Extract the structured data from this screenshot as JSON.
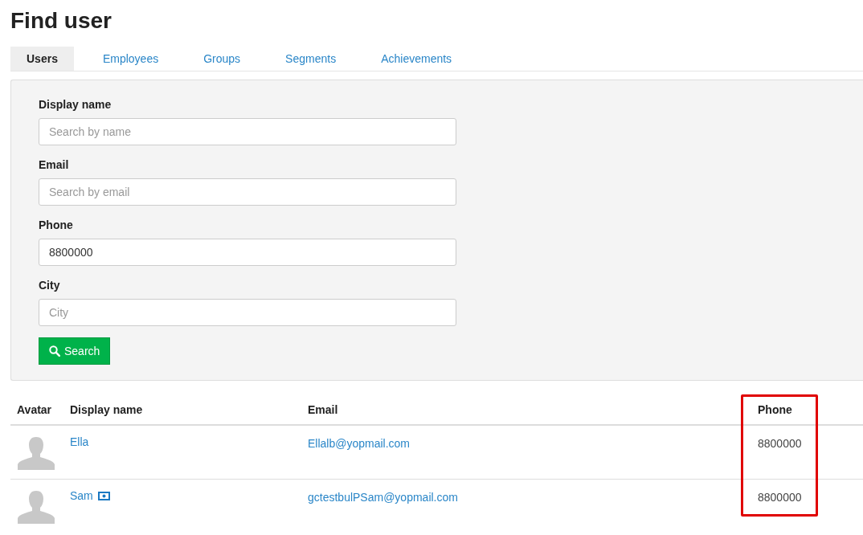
{
  "title": "Find user",
  "tabs": [
    {
      "label": "Users",
      "selected": true
    },
    {
      "label": "Employees",
      "selected": false
    },
    {
      "label": "Groups",
      "selected": false
    },
    {
      "label": "Segments",
      "selected": false
    },
    {
      "label": "Achievements",
      "selected": false
    }
  ],
  "form": {
    "fields": [
      {
        "label": "Display name",
        "placeholder": "Search by name"
      },
      {
        "label": "Email",
        "placeholder": "Search by email"
      },
      {
        "label": "Phone",
        "value": "8800000"
      },
      {
        "label": "City",
        "placeholder": "City"
      }
    ],
    "button": "Search"
  },
  "table": {
    "columns": [
      {
        "label": "Avatar",
        "highlighted": false
      },
      {
        "label": "Display name",
        "highlighted": false
      },
      {
        "label": "Email",
        "highlighted": false
      },
      {
        "label": "Phone",
        "highlighted": true
      }
    ],
    "rows": [
      {
        "name": "Ella",
        "badge": false,
        "email": "Ellalb@yopmail.com",
        "phone": "8800000"
      },
      {
        "name": "Sam",
        "badge": true,
        "email": "gctestbulPSam@yopmail.com",
        "phone": "8800000"
      }
    ]
  }
}
